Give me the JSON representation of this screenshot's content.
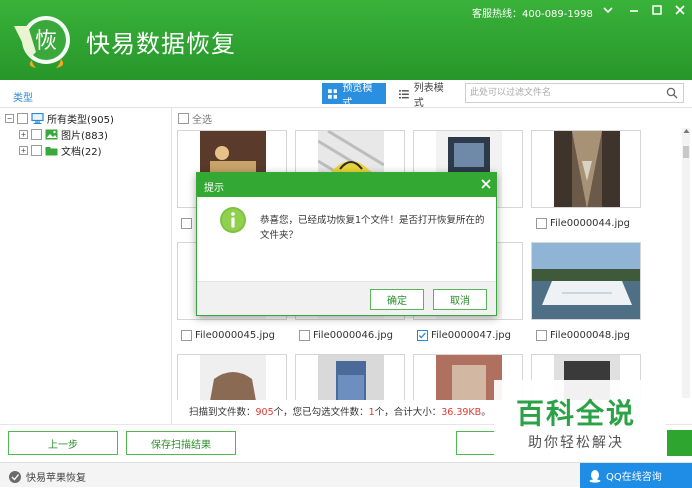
{
  "app": {
    "title": "快易数据恢复",
    "logo_text": "恢",
    "hotline": "客服热线：400-089-1998"
  },
  "toolbar": {
    "type_label": "类型",
    "preview_mode": "预览模式",
    "list_mode": "列表模式",
    "search_placeholder": "此处可以过滤文件名"
  },
  "tree": {
    "root": "所有类型(905)",
    "children": [
      "图片(883)",
      "文档(22)"
    ]
  },
  "grid": {
    "select_all": "全选",
    "files": [
      {
        "name": "",
        "checked": false
      },
      {
        "name": "",
        "checked": false
      },
      {
        "name": "",
        "checked": false
      },
      {
        "name": "File0000044.jpg",
        "checked": false
      },
      {
        "name": "File0000045.jpg",
        "checked": false
      },
      {
        "name": "File0000046.jpg",
        "checked": false
      },
      {
        "name": "File0000047.jpg",
        "checked": true
      },
      {
        "name": "File0000048.jpg",
        "checked": false
      }
    ]
  },
  "status": {
    "scanned_label": "扫描到文件数：",
    "scanned_count": "905",
    "scanned_unit": "个，您已勾选文件数：",
    "selected_count": "1",
    "selected_unit": "个，合计大小：",
    "total_size": "36.39KB",
    "end": "。"
  },
  "buttons": {
    "prev": "上一步",
    "save_scan": "保存扫描结果"
  },
  "footer": {
    "apple_link": "快易苹果恢复",
    "qq": "QQ在线咨询"
  },
  "dialog": {
    "title": "提示",
    "message": "恭喜您，已经成功恢复1个文件！是否打开恢复所在的文件夹？",
    "ok": "确定",
    "cancel": "取消"
  },
  "watermark": {
    "title": "百科全说",
    "subtitle": "助你轻松解决"
  },
  "colors": {
    "brand_green": "#2e9f30",
    "accent_blue": "#2b8fe0",
    "highlight_red": "#e03a2f"
  }
}
